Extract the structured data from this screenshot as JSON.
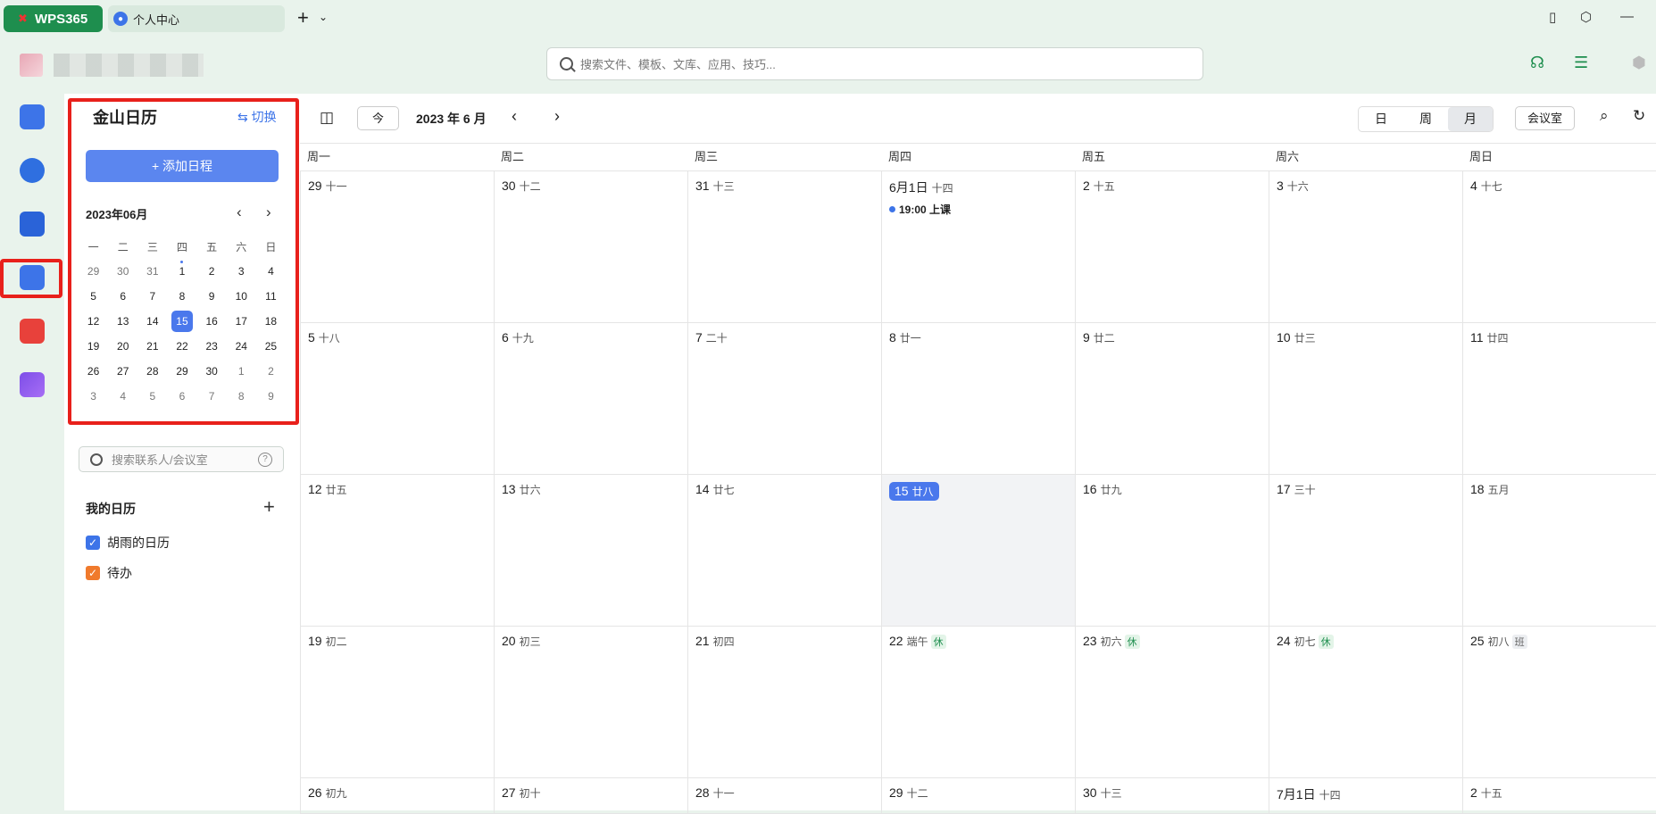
{
  "titlebar": {
    "wps_label": "WPS365",
    "tab_label": "个人中心",
    "add_tab": "+",
    "add_caret": "⌄"
  },
  "toolbar": {
    "search_placeholder": "搜索文件、模板、文库、应用、技巧..."
  },
  "sidebar": {
    "title": "金山日历",
    "switch_label": "⇆ 切换",
    "add_event_label": "+ 添加日程",
    "mini_month": "2023年06月",
    "mini_weekdays": [
      "一",
      "二",
      "三",
      "四",
      "五",
      "六",
      "日"
    ],
    "mini_days": [
      [
        "29",
        "30",
        "31",
        "1",
        "2",
        "3",
        "4"
      ],
      [
        "5",
        "6",
        "7",
        "8",
        "9",
        "10",
        "11"
      ],
      [
        "12",
        "13",
        "14",
        "15",
        "16",
        "17",
        "18"
      ],
      [
        "19",
        "20",
        "21",
        "22",
        "23",
        "24",
        "25"
      ],
      [
        "26",
        "27",
        "28",
        "29",
        "30",
        "1",
        "2"
      ],
      [
        "3",
        "4",
        "5",
        "6",
        "7",
        "8",
        "9"
      ]
    ],
    "contact_placeholder": "搜索联系人/会议室",
    "my_calendars_label": "我的日历",
    "calendars": [
      {
        "label": "胡雨的日历",
        "color": "#3d74e8"
      },
      {
        "label": "待办",
        "color": "#f07a2c"
      }
    ]
  },
  "main": {
    "today_label": "今",
    "month_title": "2023 年 6 月",
    "views": [
      "日",
      "周",
      "月"
    ],
    "active_view": "月",
    "room_label": "会议室",
    "weekday_headers": [
      "周一",
      "周二",
      "周三",
      "周四",
      "周五",
      "周六",
      "周日"
    ],
    "weeks": [
      [
        {
          "d": "29",
          "l": "十一"
        },
        {
          "d": "30",
          "l": "十二"
        },
        {
          "d": "31",
          "l": "十三"
        },
        {
          "d": "6月1日",
          "l": "十四",
          "event": "19:00 上课"
        },
        {
          "d": "2",
          "l": "十五"
        },
        {
          "d": "3",
          "l": "十六"
        },
        {
          "d": "4",
          "l": "十七"
        }
      ],
      [
        {
          "d": "5",
          "l": "十八"
        },
        {
          "d": "6",
          "l": "十九"
        },
        {
          "d": "7",
          "l": "二十"
        },
        {
          "d": "8",
          "l": "廿一"
        },
        {
          "d": "9",
          "l": "廿二"
        },
        {
          "d": "10",
          "l": "廿三"
        },
        {
          "d": "11",
          "l": "廿四"
        }
      ],
      [
        {
          "d": "12",
          "l": "廿五"
        },
        {
          "d": "13",
          "l": "廿六"
        },
        {
          "d": "14",
          "l": "廿七"
        },
        {
          "d": "15",
          "l": "廿八",
          "today": true
        },
        {
          "d": "16",
          "l": "廿九"
        },
        {
          "d": "17",
          "l": "三十"
        },
        {
          "d": "18",
          "l": "五月"
        }
      ],
      [
        {
          "d": "19",
          "l": "初二"
        },
        {
          "d": "20",
          "l": "初三"
        },
        {
          "d": "21",
          "l": "初四"
        },
        {
          "d": "22",
          "l": "端午",
          "tag": "休"
        },
        {
          "d": "23",
          "l": "初六",
          "tag": "休"
        },
        {
          "d": "24",
          "l": "初七",
          "tag": "休"
        },
        {
          "d": "25",
          "l": "初八",
          "tag": "班"
        }
      ],
      [
        {
          "d": "26",
          "l": "初九"
        },
        {
          "d": "27",
          "l": "初十"
        },
        {
          "d": "28",
          "l": "十一"
        },
        {
          "d": "29",
          "l": "十二"
        },
        {
          "d": "30",
          "l": "十三"
        },
        {
          "d": "7月1日",
          "l": "十四"
        },
        {
          "d": "2",
          "l": "十五"
        }
      ]
    ]
  },
  "colors": {
    "accent": "#4a78ec",
    "brand_green": "#1e8e4e",
    "highlight_red": "#e8201b"
  }
}
